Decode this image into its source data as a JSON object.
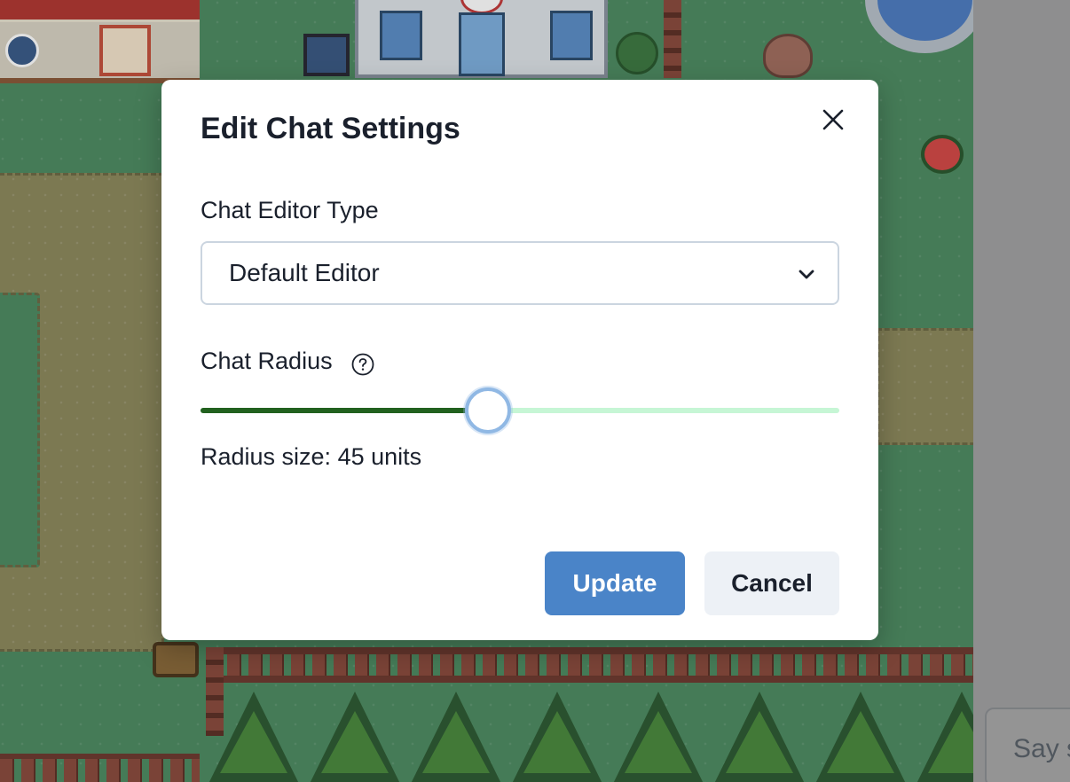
{
  "modal": {
    "title": "Edit Chat Settings",
    "close_icon": "close-icon",
    "editor_type": {
      "label": "Chat Editor Type",
      "selected": "Default Editor",
      "chevron_icon": "chevron-down-icon"
    },
    "radius": {
      "label": "Chat Radius",
      "help_icon": "question-circle-icon",
      "value_fraction": 0.45,
      "size_text": "Radius size: 45 units"
    },
    "buttons": {
      "update": "Update",
      "cancel": "Cancel"
    }
  },
  "chat": {
    "input_placeholder": "Say s"
  },
  "colors": {
    "primary": "#4a84c8",
    "slider_filled": "#22611f",
    "slider_unfilled": "#c6f6d5",
    "slider_thumb_ring": "#90b8e4"
  }
}
